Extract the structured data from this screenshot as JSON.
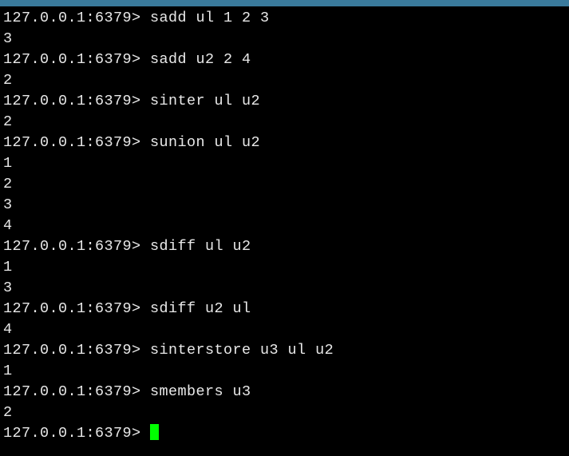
{
  "prompt": "127.0.0.1:6379>",
  "entries": [
    {
      "type": "cmd",
      "text": "sadd ul 1 2 3"
    },
    {
      "type": "out",
      "text": "3"
    },
    {
      "type": "cmd",
      "text": "sadd u2 2 4"
    },
    {
      "type": "out",
      "text": "2"
    },
    {
      "type": "cmd",
      "text": "sinter ul u2"
    },
    {
      "type": "out",
      "text": "2"
    },
    {
      "type": "cmd",
      "text": "sunion ul u2"
    },
    {
      "type": "out",
      "text": "1"
    },
    {
      "type": "out",
      "text": "2"
    },
    {
      "type": "out",
      "text": "3"
    },
    {
      "type": "out",
      "text": "4"
    },
    {
      "type": "cmd",
      "text": "sdiff ul u2"
    },
    {
      "type": "out",
      "text": "1"
    },
    {
      "type": "out",
      "text": "3"
    },
    {
      "type": "cmd",
      "text": "sdiff u2 ul"
    },
    {
      "type": "out",
      "text": "4"
    },
    {
      "type": "cmd",
      "text": "sinterstore u3 ul u2"
    },
    {
      "type": "out",
      "text": "1"
    },
    {
      "type": "cmd",
      "text": "smembers u3"
    },
    {
      "type": "out",
      "text": "2"
    },
    {
      "type": "cmd-cursor",
      "text": ""
    }
  ]
}
